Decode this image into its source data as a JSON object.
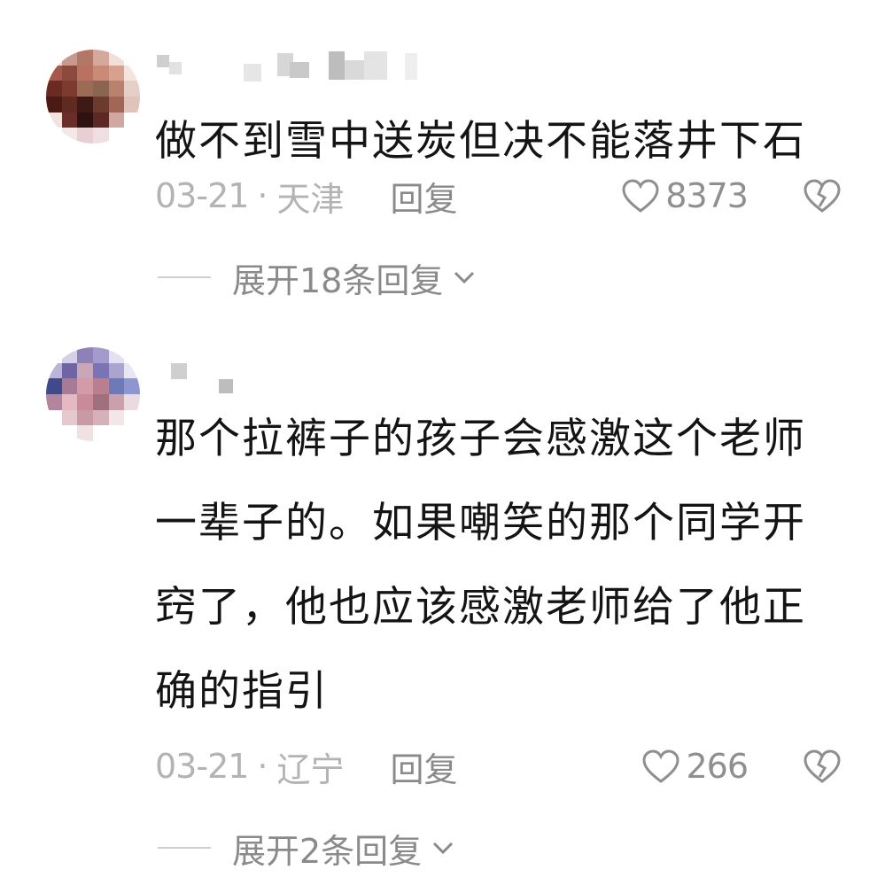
{
  "comments": [
    {
      "text": "做不到雪中送炭但决不能落井下石",
      "date": "03-21",
      "separator": "·",
      "location": "天津",
      "reply_label": "回复",
      "likes": "8373",
      "expand_label": "展开18条回复"
    },
    {
      "text": "那个拉裤子的孩子会感激这个老师一辈子的。如果嘲笑的那个同学开窍了，他也应该感激老师给了他正确的指引",
      "date": "03-21",
      "separator": "·",
      "location": "辽宁",
      "reply_label": "回复",
      "likes": "266",
      "expand_label": "展开2条回复"
    }
  ],
  "icons": {
    "like": "heart-outline-icon",
    "dislike": "broken-heart-icon",
    "expand": "chevron-down-icon"
  },
  "colors": {
    "text": "#141414",
    "meta": "#b3b3b3",
    "action": "#8a8a8a"
  }
}
